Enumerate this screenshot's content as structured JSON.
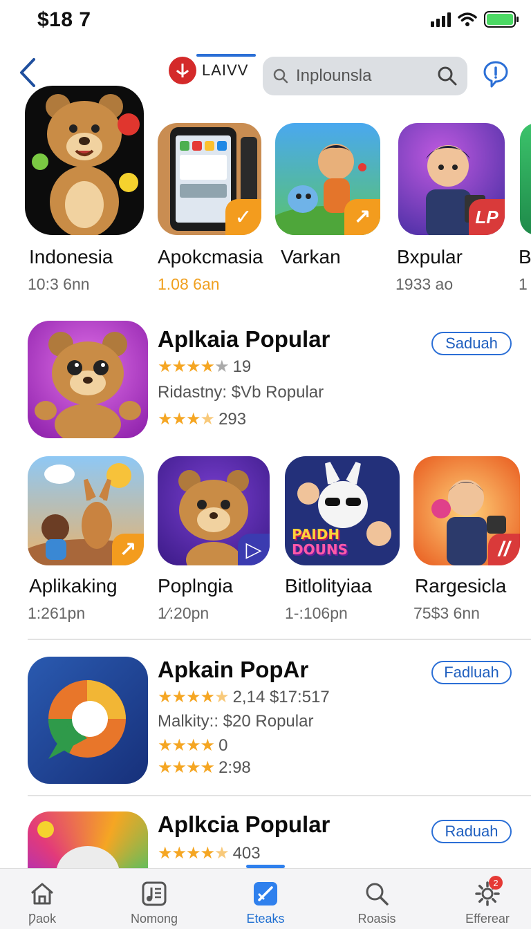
{
  "status_bar": {
    "time": "$18 7"
  },
  "header": {
    "brand_label": "LAIVV",
    "search_placeholder": "Inplounsla"
  },
  "top_row": [
    {
      "name": "Indonesia",
      "sub": "10:3 6nn",
      "sub_color": "#666666",
      "art": "bear-icon"
    },
    {
      "name": "Apokcmasia",
      "sub": "1.08 6an",
      "sub_color": "#f0a020",
      "art": "phone-screens-icon"
    },
    {
      "name": "Varkan",
      "sub": "",
      "sub_color": "#666666",
      "art": "boy-and-cat-icon"
    },
    {
      "name": "Bxpular",
      "sub": "1933  ao",
      "sub_color": "#666666",
      "art": "boy-with-phone-icon"
    },
    {
      "name": "B",
      "sub": "1",
      "sub_color": "#666666",
      "art": "partial-app-icon"
    }
  ],
  "featured_1": {
    "title": "Aplkaia Popular",
    "rating_count": "19",
    "info": "Ridastny:  $Vb Ropular",
    "rating2_count": "293",
    "button": "Saduah"
  },
  "second_row": [
    {
      "name": "Aplikaking",
      "sub": "1:261pn"
    },
    {
      "name": "Poplngia",
      "sub": "1⁄:20pn"
    },
    {
      "name": "Bitlolityiaa",
      "sub": "1-:106pn"
    },
    {
      "name": "Rargesicla",
      "sub": "75$3 6nn"
    }
  ],
  "poster_text": [
    "PAIDH",
    "DOUNS"
  ],
  "featured_2": {
    "title": "Apkain PopAr",
    "rating_count": "2,14 $17:517",
    "info": "Malkity::  $20  Ropular",
    "rating2_count": "0",
    "rating3_count": "2:98",
    "button": "Fadluah"
  },
  "featured_3": {
    "title": "Aplkcia Popular",
    "rating_count": "403",
    "button": "Raduah"
  },
  "tabs": [
    {
      "label": "Ƿaok",
      "icon": "home-icon"
    },
    {
      "label": "Nomong",
      "icon": "music-note-icon"
    },
    {
      "label": "Eteaks",
      "icon": "check-square-icon"
    },
    {
      "label": "Roasis",
      "icon": "search-icon"
    },
    {
      "label": "Efferear",
      "icon": "gear-icon",
      "badge": "2"
    }
  ],
  "colors": {
    "accent": "#2b6fd6",
    "star": "#f5a623",
    "active_tab": "#1f6fd1"
  }
}
